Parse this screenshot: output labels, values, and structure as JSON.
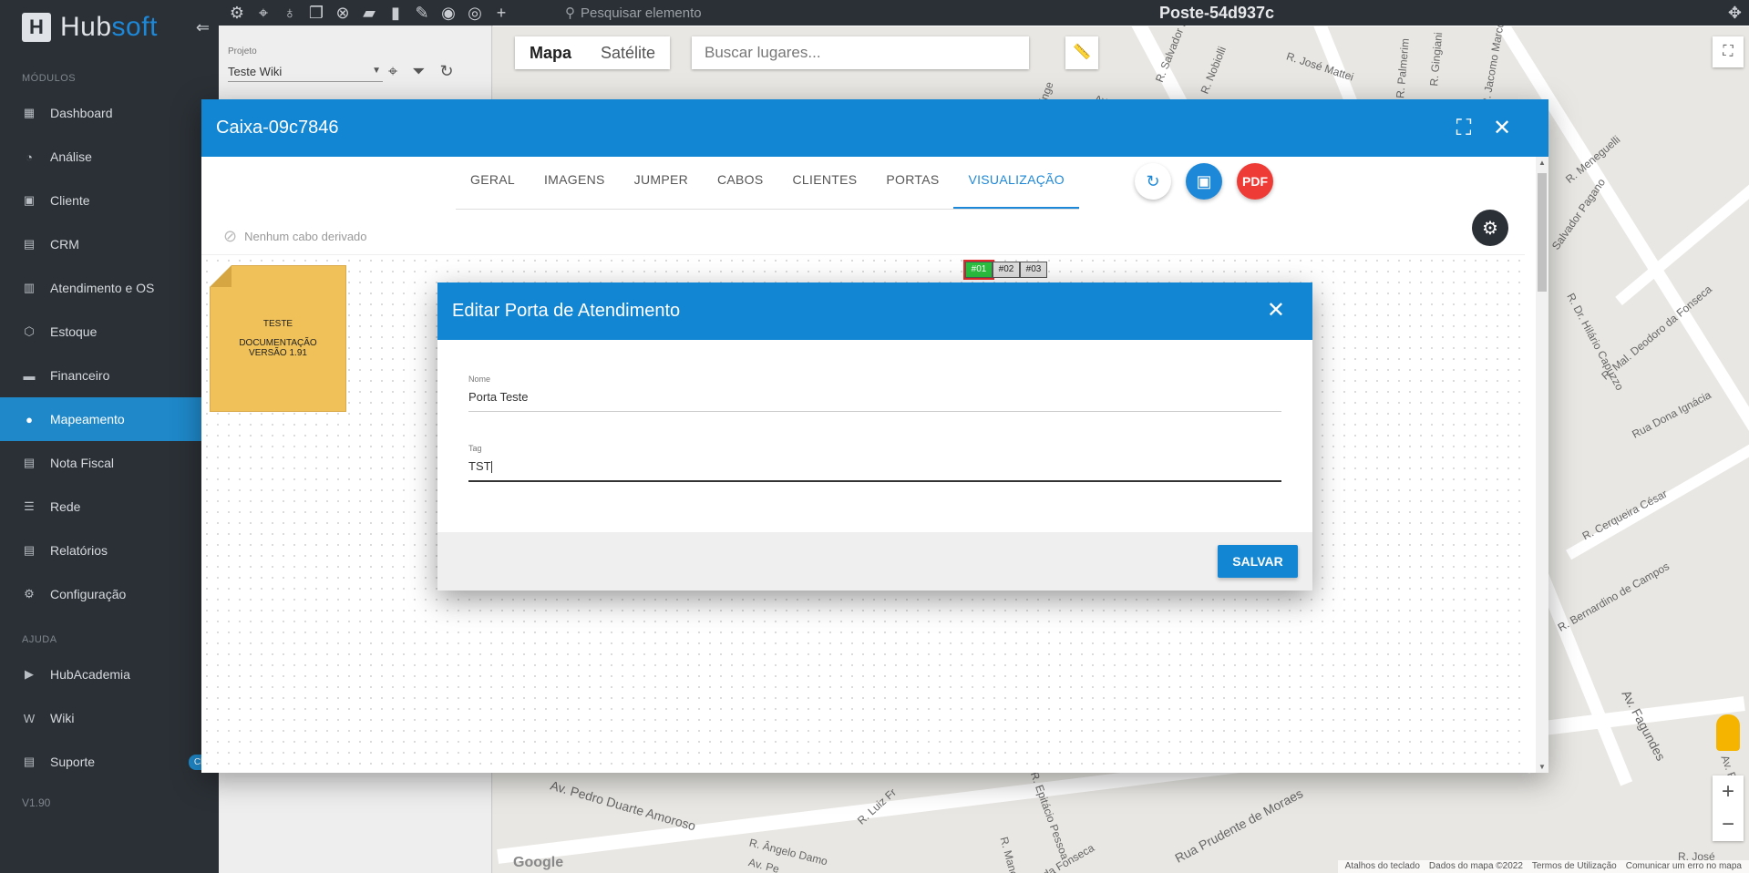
{
  "brand": {
    "hub": "Hub",
    "soft": "soft"
  },
  "sidebar": {
    "modules_label": "MÓDULOS",
    "items": [
      {
        "label": "Dashboard",
        "icon": "dashboard-icon"
      },
      {
        "label": "Análise",
        "icon": "pie-chart-icon"
      },
      {
        "label": "Cliente",
        "icon": "client-icon"
      },
      {
        "label": "CRM",
        "icon": "crm-icon"
      },
      {
        "label": "Atendimento e OS",
        "icon": "calendar-icon"
      },
      {
        "label": "Estoque",
        "icon": "box-icon"
      },
      {
        "label": "Financeiro",
        "icon": "money-icon"
      },
      {
        "label": "Mapeamento",
        "icon": "map-pin-icon",
        "active": true
      },
      {
        "label": "Nota Fiscal",
        "icon": "invoice-icon"
      },
      {
        "label": "Rede",
        "icon": "network-icon"
      },
      {
        "label": "Relatórios",
        "icon": "report-icon"
      },
      {
        "label": "Configuração",
        "icon": "gear-icon"
      }
    ],
    "help_label": "AJUDA",
    "help_items": [
      {
        "label": "HubAcademia",
        "icon": "academy-icon"
      },
      {
        "label": "Wiki",
        "icon": "wiki-icon"
      },
      {
        "label": "Suporte",
        "icon": "support-icon"
      }
    ],
    "chat_badge": "Chat",
    "version": "V1.90"
  },
  "topbar": {
    "search_placeholder": "Pesquisar elemento",
    "title": "Poste-54d937c"
  },
  "project": {
    "label": "Projeto",
    "value": "Teste Wiki"
  },
  "map": {
    "tab_map": "Mapa",
    "tab_satellite": "Satélite",
    "search_placeholder": "Buscar lugares...",
    "streets": [
      "R. José Mattei",
      "R. Nobiolli",
      "R. Salvador R",
      "R. Palmerim",
      "R. Gingiani",
      "Av. Pedro Duarte Amoroso",
      "R. Ângelo Damo",
      "R. Luiz Fr",
      "R. Epitácio Pessoa",
      "Rua Prudente de Moraes",
      "da Fonseca",
      "Av. Fagundes",
      "R. Bernardino de Campos",
      "R. Cerqueira César",
      "Rua Dona Ignácia",
      "R. Mal. Deodoro da Fonseca",
      "R. Dr. Hilário Capuzzo",
      "Salvador Pagano",
      "R. Meneguelli",
      "R. Jacomo Marco",
      "Av. Fa",
      "R. José",
      "Av. Pe",
      "R. Manoel",
      "Ringe",
      "Av."
    ],
    "footer": [
      "Atalhos do teclado",
      "Dados do mapa ©2022",
      "Termos de Utilização",
      "Comunicar um erro no mapa"
    ],
    "google": "Google"
  },
  "caixa": {
    "title": "Caixa-09c7846",
    "tabs": [
      "GERAL",
      "IMAGENS",
      "JUMPER",
      "CABOS",
      "CLIENTES",
      "PORTAS",
      "VISUALIZAÇÃO"
    ],
    "derived": "Nenhum cabo derivado",
    "note": {
      "title": "TESTE",
      "line1": "DOCUMENTAÇÃO",
      "line2": "VERSÃO 1.91"
    },
    "ports": [
      "#01",
      "#02",
      "#03"
    ],
    "pdf_label": "PDF"
  },
  "editar": {
    "title": "Editar Porta de Atendimento",
    "nome_label": "Nome",
    "nome_value": "Porta Teste",
    "tag_label": "Tag",
    "tag_value": "TST",
    "save": "SALVAR"
  },
  "colors": {
    "primary": "#1286d3",
    "sidebar": "#2b3036",
    "active_port": "#2bbf3f",
    "pdf": "#ee3b35"
  }
}
